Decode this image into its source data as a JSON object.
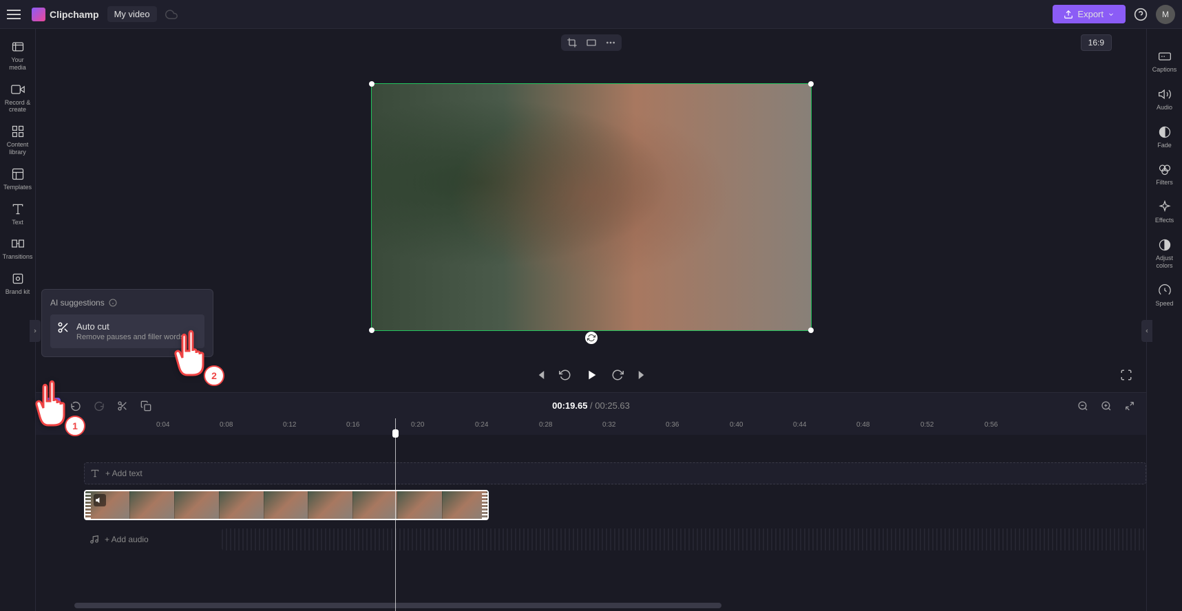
{
  "app": {
    "name": "Clipchamp",
    "project_title": "My video",
    "export_label": "Export",
    "avatar_initial": "M",
    "aspect_ratio": "16:9"
  },
  "left_sidebar": {
    "items": [
      {
        "label": "Your media"
      },
      {
        "label": "Record & create"
      },
      {
        "label": "Content library"
      },
      {
        "label": "Templates"
      },
      {
        "label": "Text"
      },
      {
        "label": "Transitions"
      },
      {
        "label": "Brand kit"
      }
    ]
  },
  "right_sidebar": {
    "items": [
      {
        "label": "Captions"
      },
      {
        "label": "Audio"
      },
      {
        "label": "Fade"
      },
      {
        "label": "Filters"
      },
      {
        "label": "Effects"
      },
      {
        "label": "Adjust colors"
      },
      {
        "label": "Speed"
      }
    ]
  },
  "ai_popup": {
    "title": "AI suggestions",
    "item": {
      "title": "Auto cut",
      "desc": "Remove pauses and filler words"
    }
  },
  "timecode": {
    "current": "00:19.65",
    "separator": " / ",
    "total": "00:25.63"
  },
  "ruler_ticks": [
    "0:04",
    "0:08",
    "0:12",
    "0:16",
    "0:20",
    "0:24",
    "0:28",
    "0:32",
    "0:36",
    "0:40",
    "0:44",
    "0:48",
    "0:52",
    "0:56"
  ],
  "tracks": {
    "text_placeholder": "+ Add text",
    "audio_placeholder": "+ Add audio"
  },
  "pointers": {
    "one": "1",
    "two": "2"
  }
}
